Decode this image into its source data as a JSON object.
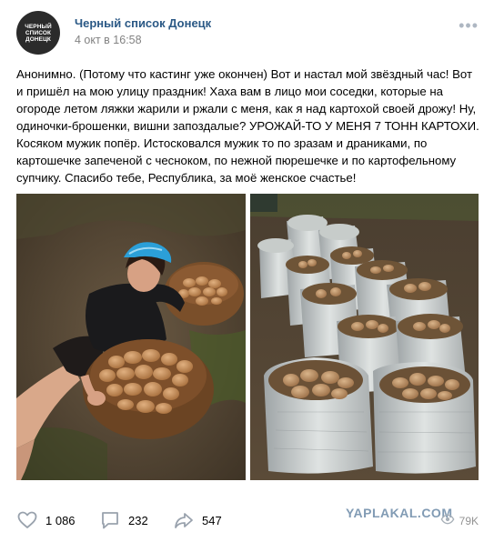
{
  "header": {
    "avatar_lines": [
      "Черный",
      "список",
      "Донецк"
    ],
    "group_name": "Черный список Донецк",
    "date": "4 окт в 16:58",
    "more_icon": "more-horizontal-icon"
  },
  "post": {
    "text": "Анонимно. (Потому что кастинг уже окончен) Вот и настал мой звёздный час! Вот и пришёл на мою улицу праздник! Хаха вам в лицо мои соседки, которые на огороде летом ляжки жарили и ржали с меня, как я над картохой своей дрожу! Ну, одиночки-брошенки, вишни запоздалые? УРОЖАЙ-ТО У МЕНЯ 7 ТОНН КАРТОХИ. Косяком мужик попёр. Истосковался мужик то по зразам и драниками, по картошечке запеченой с чесноком, по нежной пюрешечке и по картофельному супчику. Спасибо тебе, Республика, за моё женское счастье!"
  },
  "actions": {
    "likes": "1 086",
    "comments": "232",
    "shares": "547",
    "views": "79K"
  },
  "watermark": "YAPLAKAL.COM",
  "colors": {
    "link": "#2a5885",
    "muted": "#828282",
    "icon": "#99a2ad"
  }
}
